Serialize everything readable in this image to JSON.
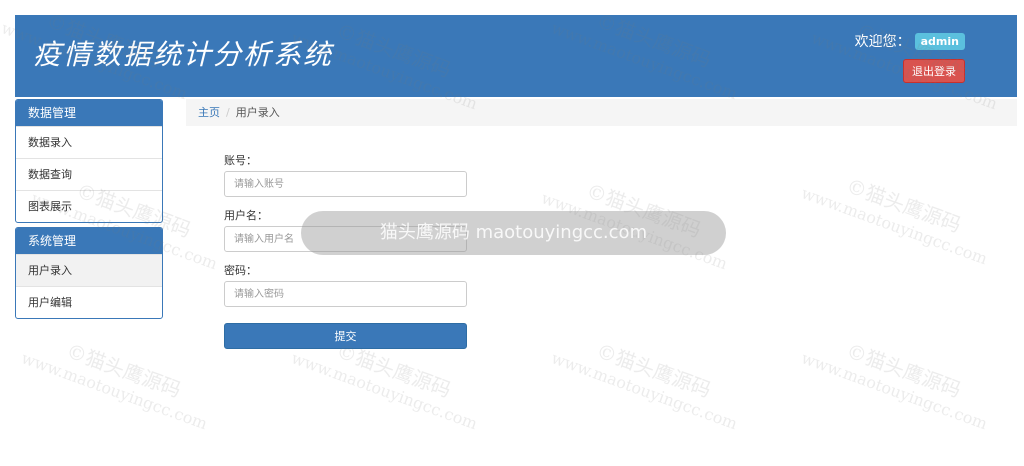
{
  "header": {
    "title": "疫情数据统计分析系统",
    "welcome": "欢迎您：",
    "username": "admin",
    "logout_label": "退出登录"
  },
  "sidebar": {
    "panels": [
      {
        "heading": "数据管理",
        "items": [
          {
            "label": "数据录入"
          },
          {
            "label": "数据查询"
          },
          {
            "label": "图表展示"
          }
        ]
      },
      {
        "heading": "系统管理",
        "items": [
          {
            "label": "用户录入"
          },
          {
            "label": "用户编辑"
          }
        ]
      }
    ]
  },
  "breadcrumb": {
    "home": "主页",
    "separator": "/",
    "current": "用户录入"
  },
  "form": {
    "account_label": "账号：",
    "account_placeholder": "请输入账号",
    "username_label": "用户名：",
    "username_placeholder": "请输入用户名",
    "password_label": "密码：",
    "password_placeholder": "请输入密码",
    "submit_label": "提交"
  },
  "watermark": {
    "brand": "©猫头鹰源码",
    "url": "www.maotouyingcc.com",
    "toast": "猫头鹰源码 maotouyingcc.com"
  },
  "colors": {
    "primary": "#3a78b8",
    "danger": "#d9534f",
    "badge": "#5bc0de"
  }
}
